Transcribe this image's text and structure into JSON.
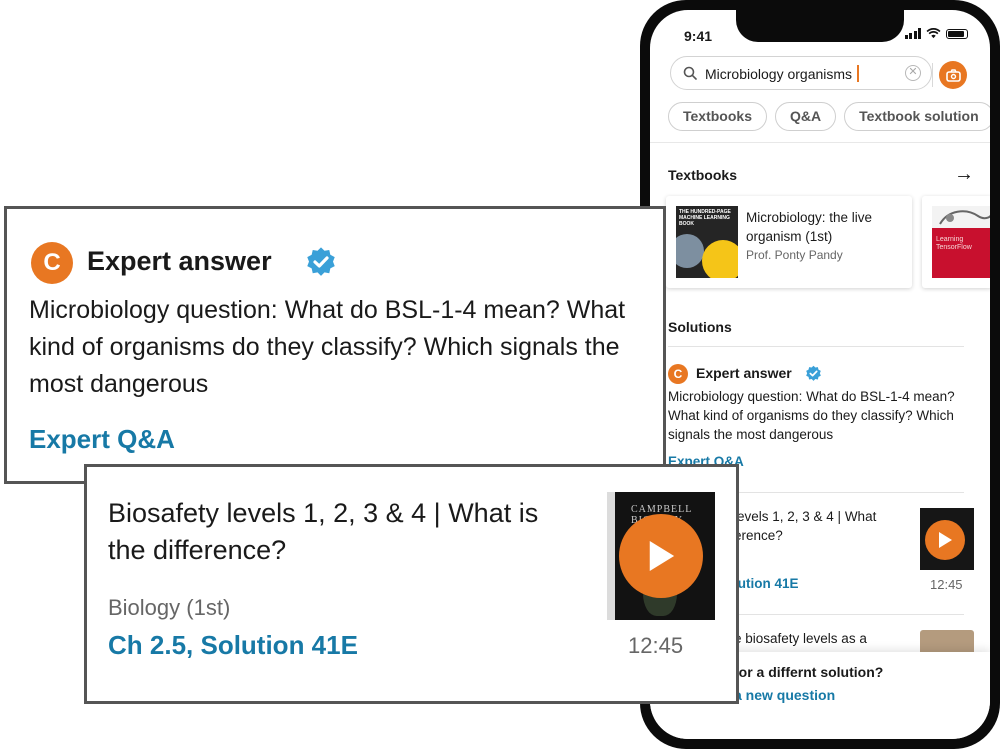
{
  "status": {
    "time": "9:41"
  },
  "search": {
    "query": "Microbiology organisms"
  },
  "chips": [
    "Textbooks",
    "Q&A",
    "Textbook solution"
  ],
  "textbooks": {
    "section_title": "Textbooks",
    "items": [
      {
        "cover_text": "THE HUNDRED-PAGE MACHINE LEARNING BOOK",
        "title": "Microbiology: the live organism (1st)",
        "author": "Prof. Ponty Pandy"
      },
      {
        "cover_text": "Learning TensorFlow"
      }
    ]
  },
  "solutions": {
    "section_title": "Solutions",
    "expert_answer": {
      "badge_letter": "C",
      "label": "Expert answer",
      "question": "Microbiology question: What do BSL-1-4 mean? What kind of organisms do they classify? Which signals the most dangerous",
      "link": "Expert Q&A"
    },
    "video_solution": {
      "title": "Biosafety levels 1, 2, 3 & 4 | What is the difference?",
      "title_partial": "levels 1, 2, 3 & 4 | What\nerence?",
      "book_title": "CAMPBELL BIOLOGY",
      "subtitle": "Biology (1st)",
      "subtitle_partial": ")",
      "link": "Ch 2.5, Solution 41E",
      "link_partial": "lution 41E",
      "duration": "12:45"
    },
    "third_item_partial": "e biosafety levels as a"
  },
  "bottom_prompt": {
    "question_partial": "for a differnt solution?",
    "link_partial": "a new question"
  },
  "colors": {
    "accent_orange": "#e87722",
    "link_blue": "#1779a6",
    "verified_blue": "#3aa0d8"
  }
}
